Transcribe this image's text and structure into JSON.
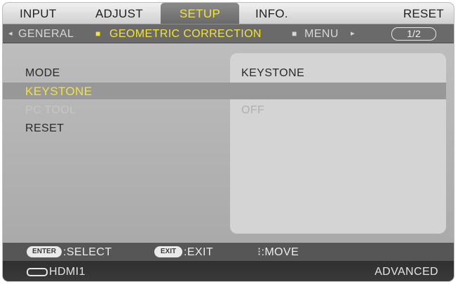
{
  "tabs": [
    {
      "label": "INPUT",
      "active": false
    },
    {
      "label": "ADJUST",
      "active": false
    },
    {
      "label": "SETUP",
      "active": true
    },
    {
      "label": "INFO.",
      "active": false
    },
    {
      "label": "RESET",
      "active": false
    }
  ],
  "subtabs": {
    "left_arrow": "◂",
    "items": [
      {
        "label": "GENERAL",
        "active": false
      },
      {
        "label": "GEOMETRIC CORRECTION",
        "active": true
      },
      {
        "label": "MENU",
        "active": false
      }
    ],
    "right_arrow": "▸",
    "page": "1/2"
  },
  "menu": {
    "rows": [
      {
        "label": "MODE",
        "value": "KEYSTONE",
        "selected": false,
        "disabled": false
      },
      {
        "label": "KEYSTONE",
        "value": "",
        "selected": true,
        "disabled": false
      },
      {
        "label": "PC TOOL",
        "value": "OFF",
        "selected": false,
        "disabled": true
      },
      {
        "label": "RESET",
        "value": "",
        "selected": false,
        "disabled": false
      }
    ]
  },
  "hints": {
    "enter_key": "ENTER",
    "select": ":SELECT",
    "exit_key": "EXIT",
    "exit": ":EXIT",
    "move": "⁝:MOVE"
  },
  "status": {
    "source_icon": "hdmi-connector-icon",
    "source": "HDMI1",
    "menu_mode": "ADVANCED"
  },
  "colors": {
    "highlight": "#f2e33a",
    "panel": "#bdbdbd",
    "value_panel": "#d4d4d4"
  }
}
